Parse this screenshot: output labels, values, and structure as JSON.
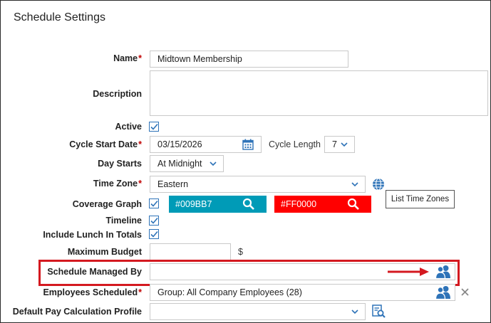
{
  "title": "Schedule Settings",
  "fields": {
    "name_label": "Name",
    "name_value": "Midtown Membership",
    "description_label": "Description",
    "active_label": "Active",
    "cycle_start_label": "Cycle Start Date",
    "cycle_start_value": "03/15/2026",
    "cycle_length_label": "Cycle Length",
    "cycle_length_value": "7",
    "day_starts_label": "Day Starts",
    "day_starts_value": "At Midnight",
    "time_zone_label": "Time Zone",
    "time_zone_value": "Eastern",
    "time_zone_tooltip": "List Time Zones",
    "coverage_label": "Coverage Graph",
    "coverage_color1": "#009BB7",
    "coverage_color2": "#FF0000",
    "timeline_label": "Timeline",
    "lunch_label": "Include Lunch In Totals",
    "max_budget_label": "Maximum Budget",
    "currency_symbol": "$",
    "managed_by_label": "Schedule Managed By",
    "managed_by_value": "",
    "employees_label": "Employees Scheduled",
    "employees_value": "Group: All Company Employees (28)",
    "pay_calc_label": "Default Pay Calculation Profile",
    "pay_calc_value": "",
    "required_mark": "*"
  },
  "colors": {
    "accent": "#2e73b8",
    "required": "#c00000",
    "highlight": "#d41920",
    "swatch1": "#009BB7",
    "swatch2": "#FF0000"
  },
  "icons": [
    "calendar-icon",
    "globe-icon",
    "search-icon",
    "people-icon",
    "close-icon",
    "chevron-down-icon",
    "checkmark-icon",
    "search-list-icon",
    "arrow-icon"
  ]
}
